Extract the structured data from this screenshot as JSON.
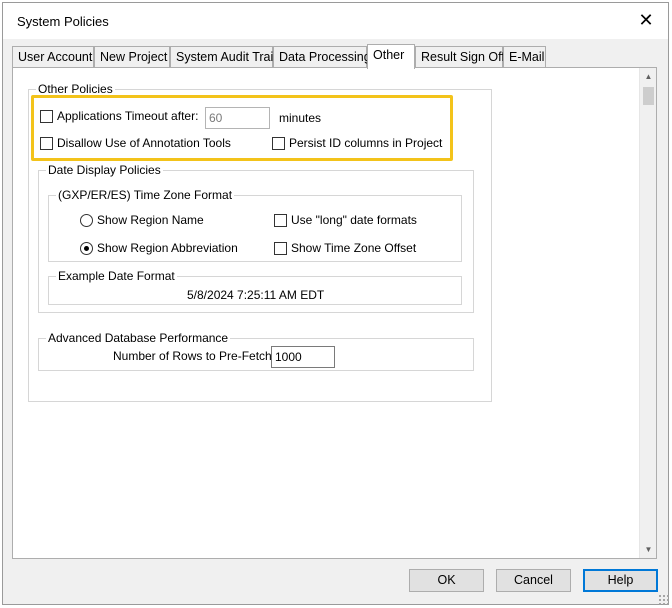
{
  "window": {
    "title": "System Policies",
    "close_glyph": "✕"
  },
  "tabs": [
    {
      "label": "User Account"
    },
    {
      "label": "New Project"
    },
    {
      "label": "System Audit Trail"
    },
    {
      "label": "Data Processing"
    },
    {
      "label": "Other",
      "active": true
    },
    {
      "label": "Result Sign Off"
    },
    {
      "label": "E-Mail"
    }
  ],
  "other_policies": {
    "legend": "Other Policies",
    "timeout": {
      "label": "Applications Timeout after:",
      "checked": false,
      "value": "60",
      "unit": "minutes"
    },
    "disallow_annotation": {
      "label": "Disallow Use of Annotation Tools",
      "checked": false
    },
    "persist_id": {
      "label": "Persist ID columns in Project",
      "checked": false
    }
  },
  "date_display": {
    "legend": "Date Display Policies",
    "tz_format": {
      "legend": "(GXP/ER/ES) Time Zone Format",
      "show_region_name": {
        "label": "Show Region Name",
        "selected": false
      },
      "show_region_abbrev": {
        "label": "Show Region Abbreviation",
        "selected": true
      },
      "use_long_formats": {
        "label": "Use \"long\" date formats",
        "checked": false
      },
      "show_tz_offset": {
        "label": "Show Time Zone Offset",
        "checked": false
      }
    },
    "example": {
      "legend": "Example Date Format",
      "value": "5/8/2024 7:25:11 AM EDT"
    }
  },
  "adv_db": {
    "legend": "Advanced Database Performance",
    "rows_label": "Number of Rows to Pre-Fetch:",
    "rows_value": "1000"
  },
  "buttons": {
    "ok": "OK",
    "cancel": "Cancel",
    "help": "Help"
  },
  "scrollbar": {
    "up_glyph": "▲",
    "down_glyph": "▼"
  },
  "colors": {
    "highlight": "#f3c31a",
    "default_button_border": "#0078d7"
  }
}
